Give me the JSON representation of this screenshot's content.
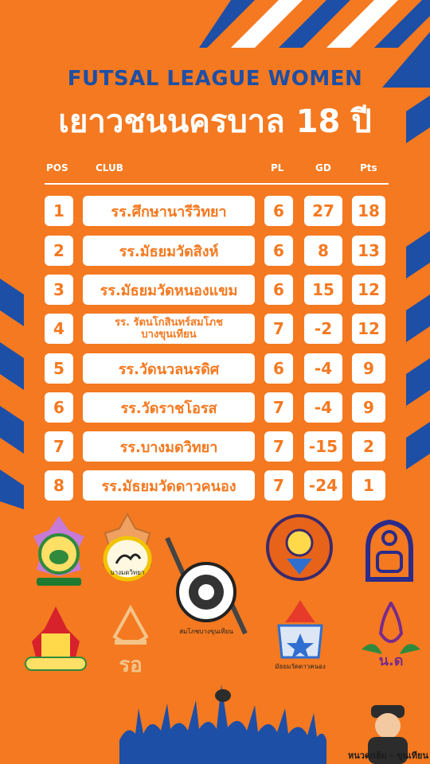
{
  "title": {
    "line1": "FUTSAL LEAGUE WOMEN",
    "line2": "เยาวชนนครบาล 18 ปี"
  },
  "table": {
    "headers": {
      "pos": "POS",
      "club": "CLUB",
      "pl": "PL",
      "gd": "GD",
      "pts": "Pts"
    },
    "rows": [
      {
        "pos": "1",
        "club": "รร.ศึกษานารีวิทยา",
        "pl": "6",
        "gd": "27",
        "pts": "18"
      },
      {
        "pos": "2",
        "club": "รร.มัธยมวัดสิงห์",
        "pl": "6",
        "gd": "8",
        "pts": "13"
      },
      {
        "pos": "3",
        "club": "รร.มัธยมวัดหนองแขม",
        "pl": "6",
        "gd": "15",
        "pts": "12"
      },
      {
        "pos": "4",
        "club_line1": "รร. รัตนโกสินทร์สมโภช",
        "club_line2": "บางขุนเทียน",
        "pl": "7",
        "gd": "-2",
        "pts": "12"
      },
      {
        "pos": "5",
        "club": "รร.วัดนวลนรดิศ",
        "pl": "6",
        "gd": "-4",
        "pts": "9"
      },
      {
        "pos": "6",
        "club": "รร.วัดราชโอรส",
        "pl": "7",
        "gd": "-4",
        "pts": "9"
      },
      {
        "pos": "7",
        "club": "รร.บางมดวิทยา",
        "pl": "7",
        "gd": "-15",
        "pts": "2"
      },
      {
        "pos": "8",
        "club": "รร.มัธยมวัดดาวคนอง",
        "pl": "7",
        "gd": "-24",
        "pts": "1"
      }
    ]
  },
  "logos": {
    "bangmod_caption": "บางมดวิทยา",
    "rattanakosin_caption": "สมโภชบางขุนเทียน",
    "daokanong_caption": "มัธยมวัดดาวคนอง",
    "nd_caption": "น.ด",
    "ro_caption": "รอ"
  },
  "credit": "หนวดกล้ม - ขุนเทียน",
  "colors": {
    "background": "#f47920",
    "accent_blue": "#1d4fa6",
    "white": "#ffffff"
  }
}
